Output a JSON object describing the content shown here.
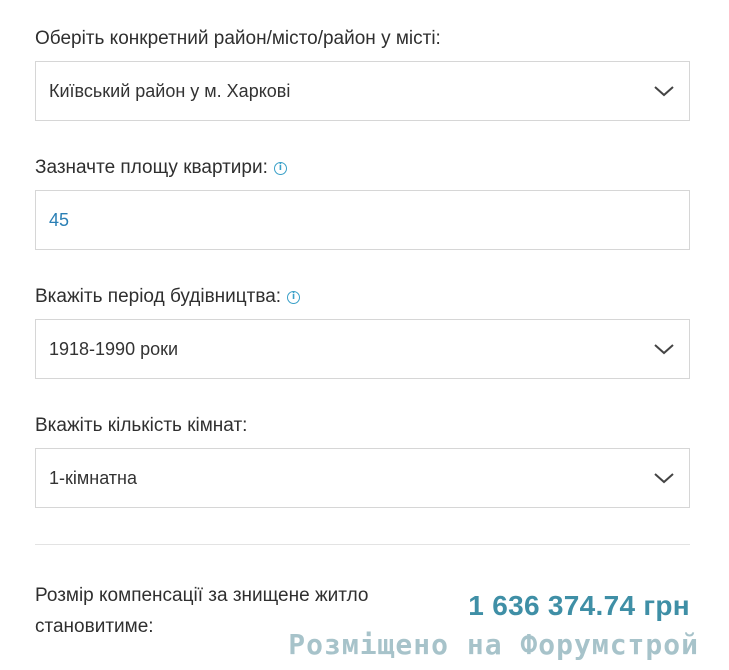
{
  "district": {
    "label": "Оберіть конкретний район/місто/район у місті:",
    "selected": "Київський район у м. Харкові"
  },
  "area": {
    "label": "Зазначте площу квартири:",
    "value": "45"
  },
  "period": {
    "label": "Вкажіть період будівництва:",
    "selected": "1918-1990 роки"
  },
  "rooms": {
    "label": "Вкажіть кількість кімнат:",
    "selected": "1-кімнатна"
  },
  "result": {
    "label": "Розмір компенсації за знищене житло становитиме:",
    "value": "1 636 374.74 грн"
  },
  "watermark": "Розміщено на Форумстрой",
  "colors": {
    "accent": "#3f8fa6",
    "input_text": "#2a7fb5",
    "border": "#d6d6d6"
  }
}
